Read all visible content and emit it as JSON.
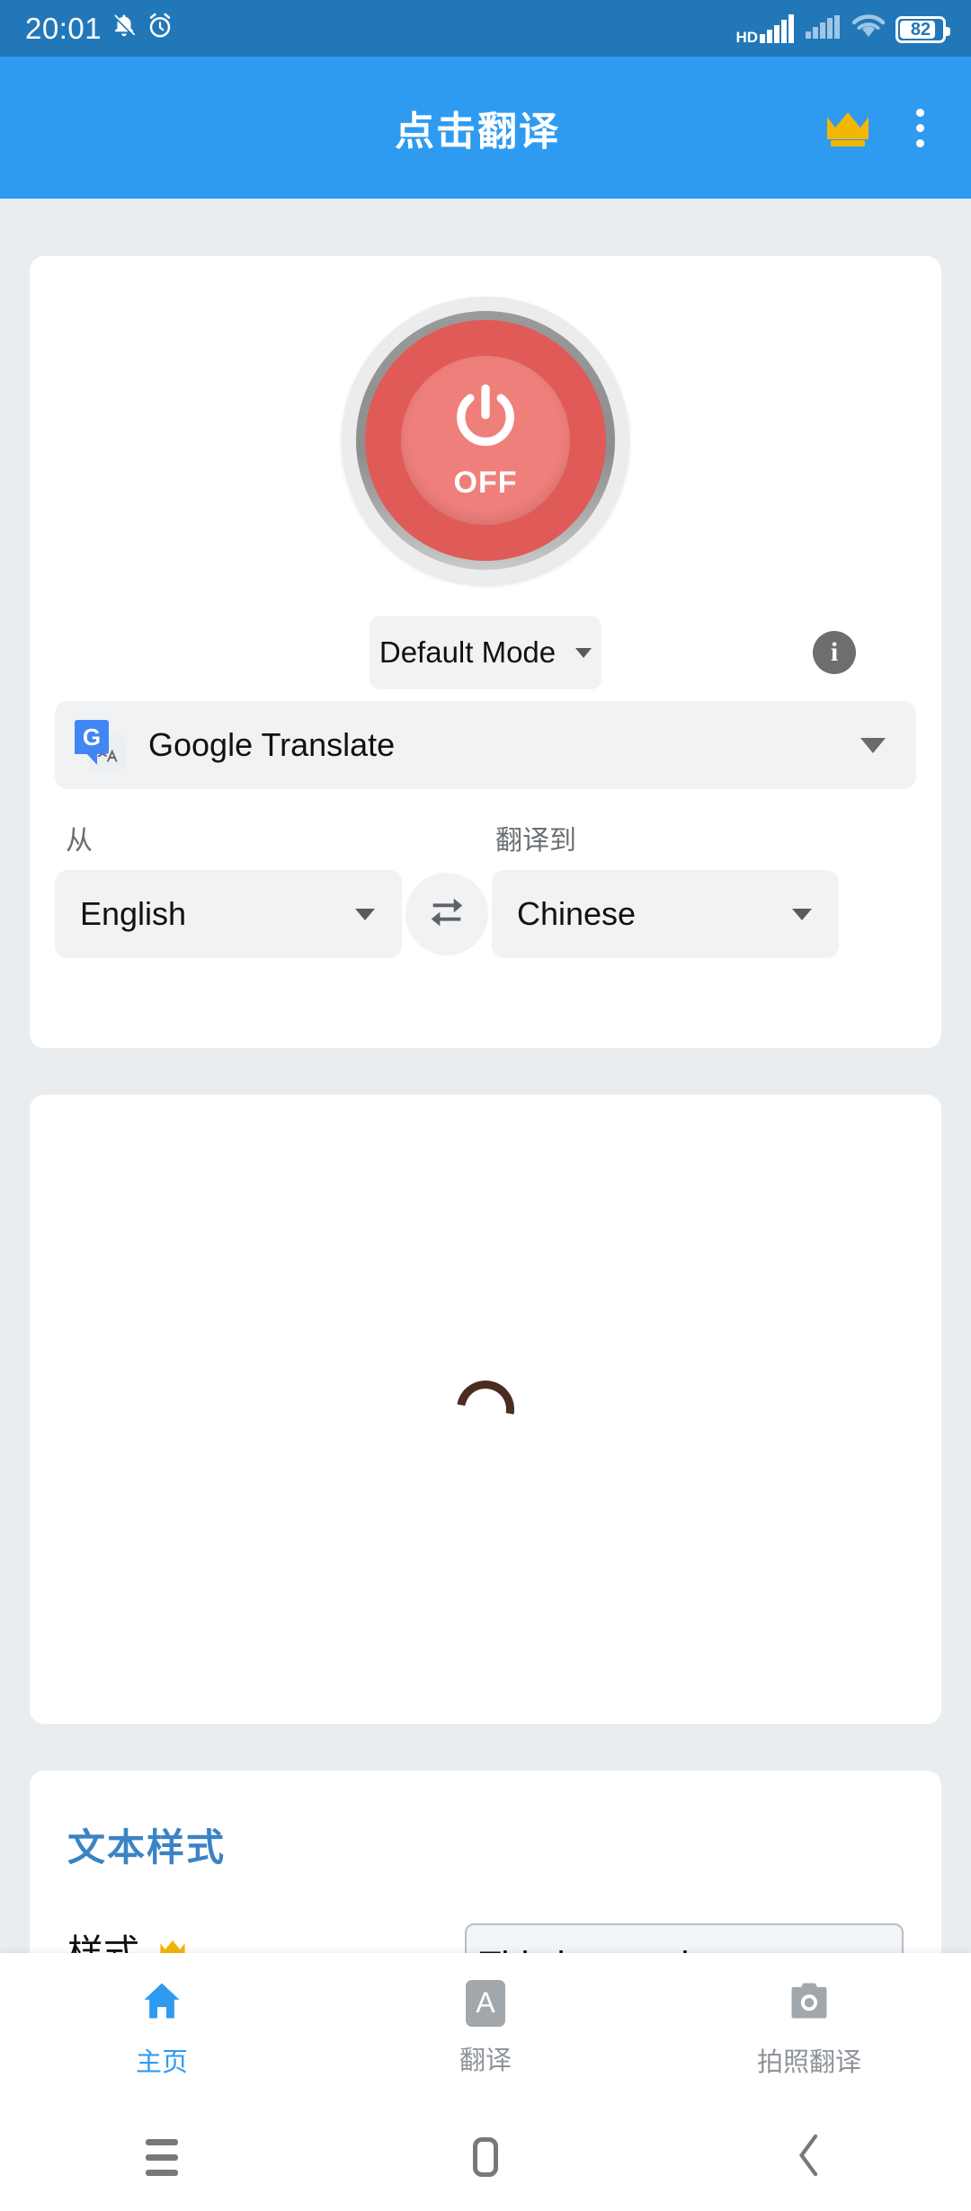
{
  "statusbar": {
    "time": "20:01",
    "icons": [
      "bell-mute-icon",
      "alarm-clock-icon",
      "signal-hd-icon",
      "signal-icon",
      "wifi-icon",
      "battery-icon"
    ],
    "hd_label": "HD",
    "battery_level": "82"
  },
  "appbar": {
    "title": "点击翻译",
    "crown_icon": "crown-icon",
    "overflow_icon": "overflow-menu-icon"
  },
  "main_card": {
    "power_button": {
      "state_label": "OFF",
      "icon": "power-icon",
      "color_ring": "#e05b57",
      "color_inner": "#ef7f7b"
    },
    "mode": {
      "value": "Default Mode",
      "info_label": "i"
    },
    "engine": {
      "name": "Google Translate",
      "icon": "google-translate-icon",
      "icon_letter": "G"
    },
    "languages": {
      "from_label": "从",
      "from_value": "English",
      "to_label": "翻译到",
      "to_value": "Chinese",
      "swap_icon": "swap-arrows-icon"
    }
  },
  "loading_card": {
    "spinner": "loading-spinner",
    "spinner_color": "#4a2c21"
  },
  "style_card": {
    "title": "文本样式",
    "style_label": "样式",
    "premium_icon": "crown-icon",
    "sample_text": "This is sample text"
  },
  "bottom_nav": {
    "items": [
      {
        "label": "主页",
        "icon": "home-icon",
        "active": true
      },
      {
        "label": "翻译",
        "icon": "letter-a-icon",
        "active": false
      },
      {
        "label": "拍照翻译",
        "icon": "camera-icon",
        "active": false
      }
    ],
    "active_color": "#2f9bf0"
  },
  "system_nav": {
    "recents": "recents-icon",
    "home": "home-square-icon",
    "back": "back-chevron-icon"
  }
}
